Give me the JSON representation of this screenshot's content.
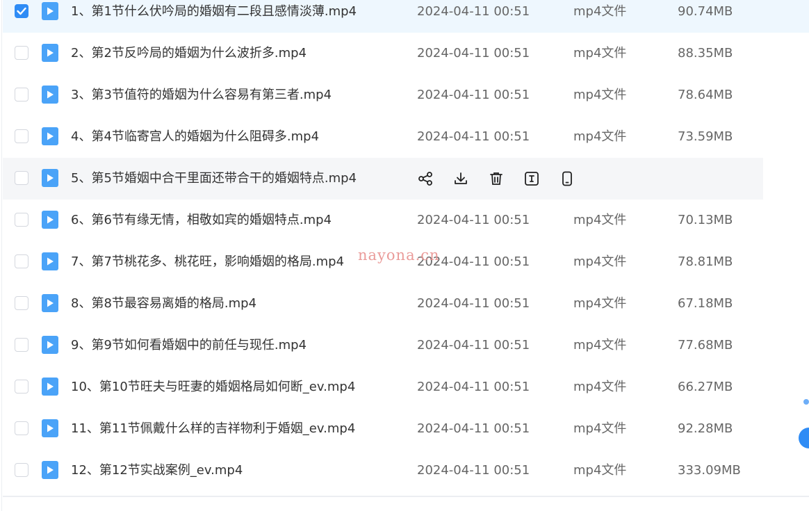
{
  "files": [
    {
      "name": "1、第1节什么伏吟局的婚姻有二段且感情淡薄.mp4",
      "date": "2024-04-11 00:51",
      "type": "mp4文件",
      "size": "90.74MB",
      "checked": true
    },
    {
      "name": "2、第2节反吟局的婚姻为什么波折多.mp4",
      "date": "2024-04-11 00:51",
      "type": "mp4文件",
      "size": "88.35MB",
      "checked": false
    },
    {
      "name": "3、第3节值符的婚姻为什么容易有第三者.mp4",
      "date": "2024-04-11 00:51",
      "type": "mp4文件",
      "size": "78.64MB",
      "checked": false
    },
    {
      "name": "4、第4节临寄宫人的婚姻为什么阻碍多.mp4",
      "date": "2024-04-11 00:51",
      "type": "mp4文件",
      "size": "73.59MB",
      "checked": false
    },
    {
      "name": "5、第5节婚姻中合干里面还带合干的婚姻特点.mp4",
      "date": "",
      "type": "",
      "size": "",
      "checked": false,
      "hover": true
    },
    {
      "name": "6、第6节有缘无情，相敬如宾的婚姻特点.mp4",
      "date": "2024-04-11 00:51",
      "type": "mp4文件",
      "size": "70.13MB",
      "checked": false
    },
    {
      "name": "7、第7节桃花多、桃花旺，影响婚姻的格局.mp4",
      "date": "2024-04-11 00:51",
      "type": "mp4文件",
      "size": "78.81MB",
      "checked": false
    },
    {
      "name": "8、第8节最容易离婚的格局.mp4",
      "date": "2024-04-11 00:51",
      "type": "mp4文件",
      "size": "67.18MB",
      "checked": false
    },
    {
      "name": "9、第9节如何看婚姻中的前任与现任.mp4",
      "date": "2024-04-11 00:51",
      "type": "mp4文件",
      "size": "77.68MB",
      "checked": false
    },
    {
      "name": "10、第10节旺夫与旺妻的婚姻格局如何断_ev.mp4",
      "date": "2024-04-11 00:51",
      "type": "mp4文件",
      "size": "66.27MB",
      "checked": false
    },
    {
      "name": "11、第11节佩戴什么样的吉祥物利于婚姻_ev.mp4",
      "date": "2024-04-11 00:51",
      "type": "mp4文件",
      "size": "92.28MB",
      "checked": false
    },
    {
      "name": "12、第12节实战案例_ev.mp4",
      "date": "2024-04-11 00:51",
      "type": "mp4文件",
      "size": "333.09MB",
      "checked": false
    }
  ],
  "hover_actions": [
    "share-icon",
    "download-icon",
    "delete-icon",
    "rename-icon",
    "phone-icon"
  ],
  "watermark": "nayona.cn",
  "colors": {
    "accent": "#2f8cf5",
    "selected_row": "#eef7fe",
    "hover_row": "#f5f6f8",
    "watermark": "#e8918f"
  }
}
